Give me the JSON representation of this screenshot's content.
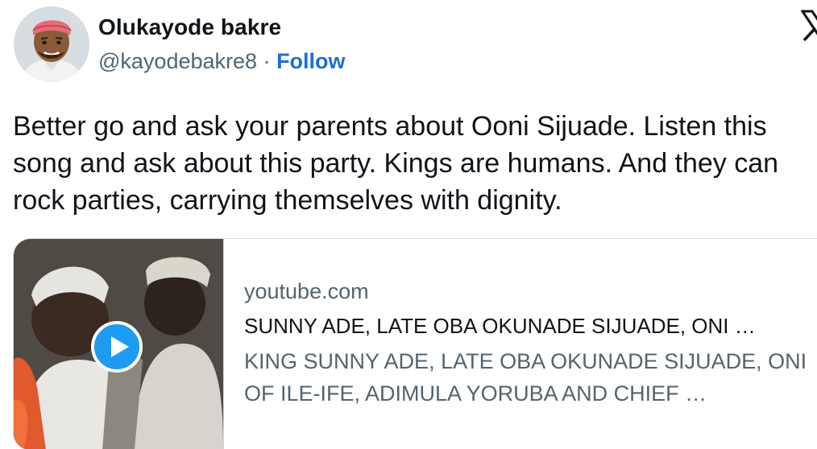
{
  "author": {
    "display_name": "Olukayode bakre",
    "handle": "@kayodebakre8",
    "separator": "·",
    "follow_label": "Follow"
  },
  "tweet": {
    "text": "Better go and ask your parents about Ooni Sijuade. Listen this song and ask about this party. Kings are humans. And they can rock parties, carrying themselves with dignity."
  },
  "card": {
    "domain": "youtube.com",
    "title": "SUNNY ADE, LATE OBA OKUNADE SIJUADE, ONI …",
    "description": "KING SUNNY ADE, LATE OBA OKUNADE SIJUADE, ONI OF ILE-IFE, ADIMULA YORUBA AND CHIEF …"
  },
  "colors": {
    "follow": "#1d6fd0",
    "secondary_text": "#536471",
    "primary_text": "#0f1419",
    "border": "#cfd9de",
    "play_button": "#1d9bf0"
  },
  "icons": {
    "logo": "x-logo-icon",
    "play": "play-icon"
  }
}
